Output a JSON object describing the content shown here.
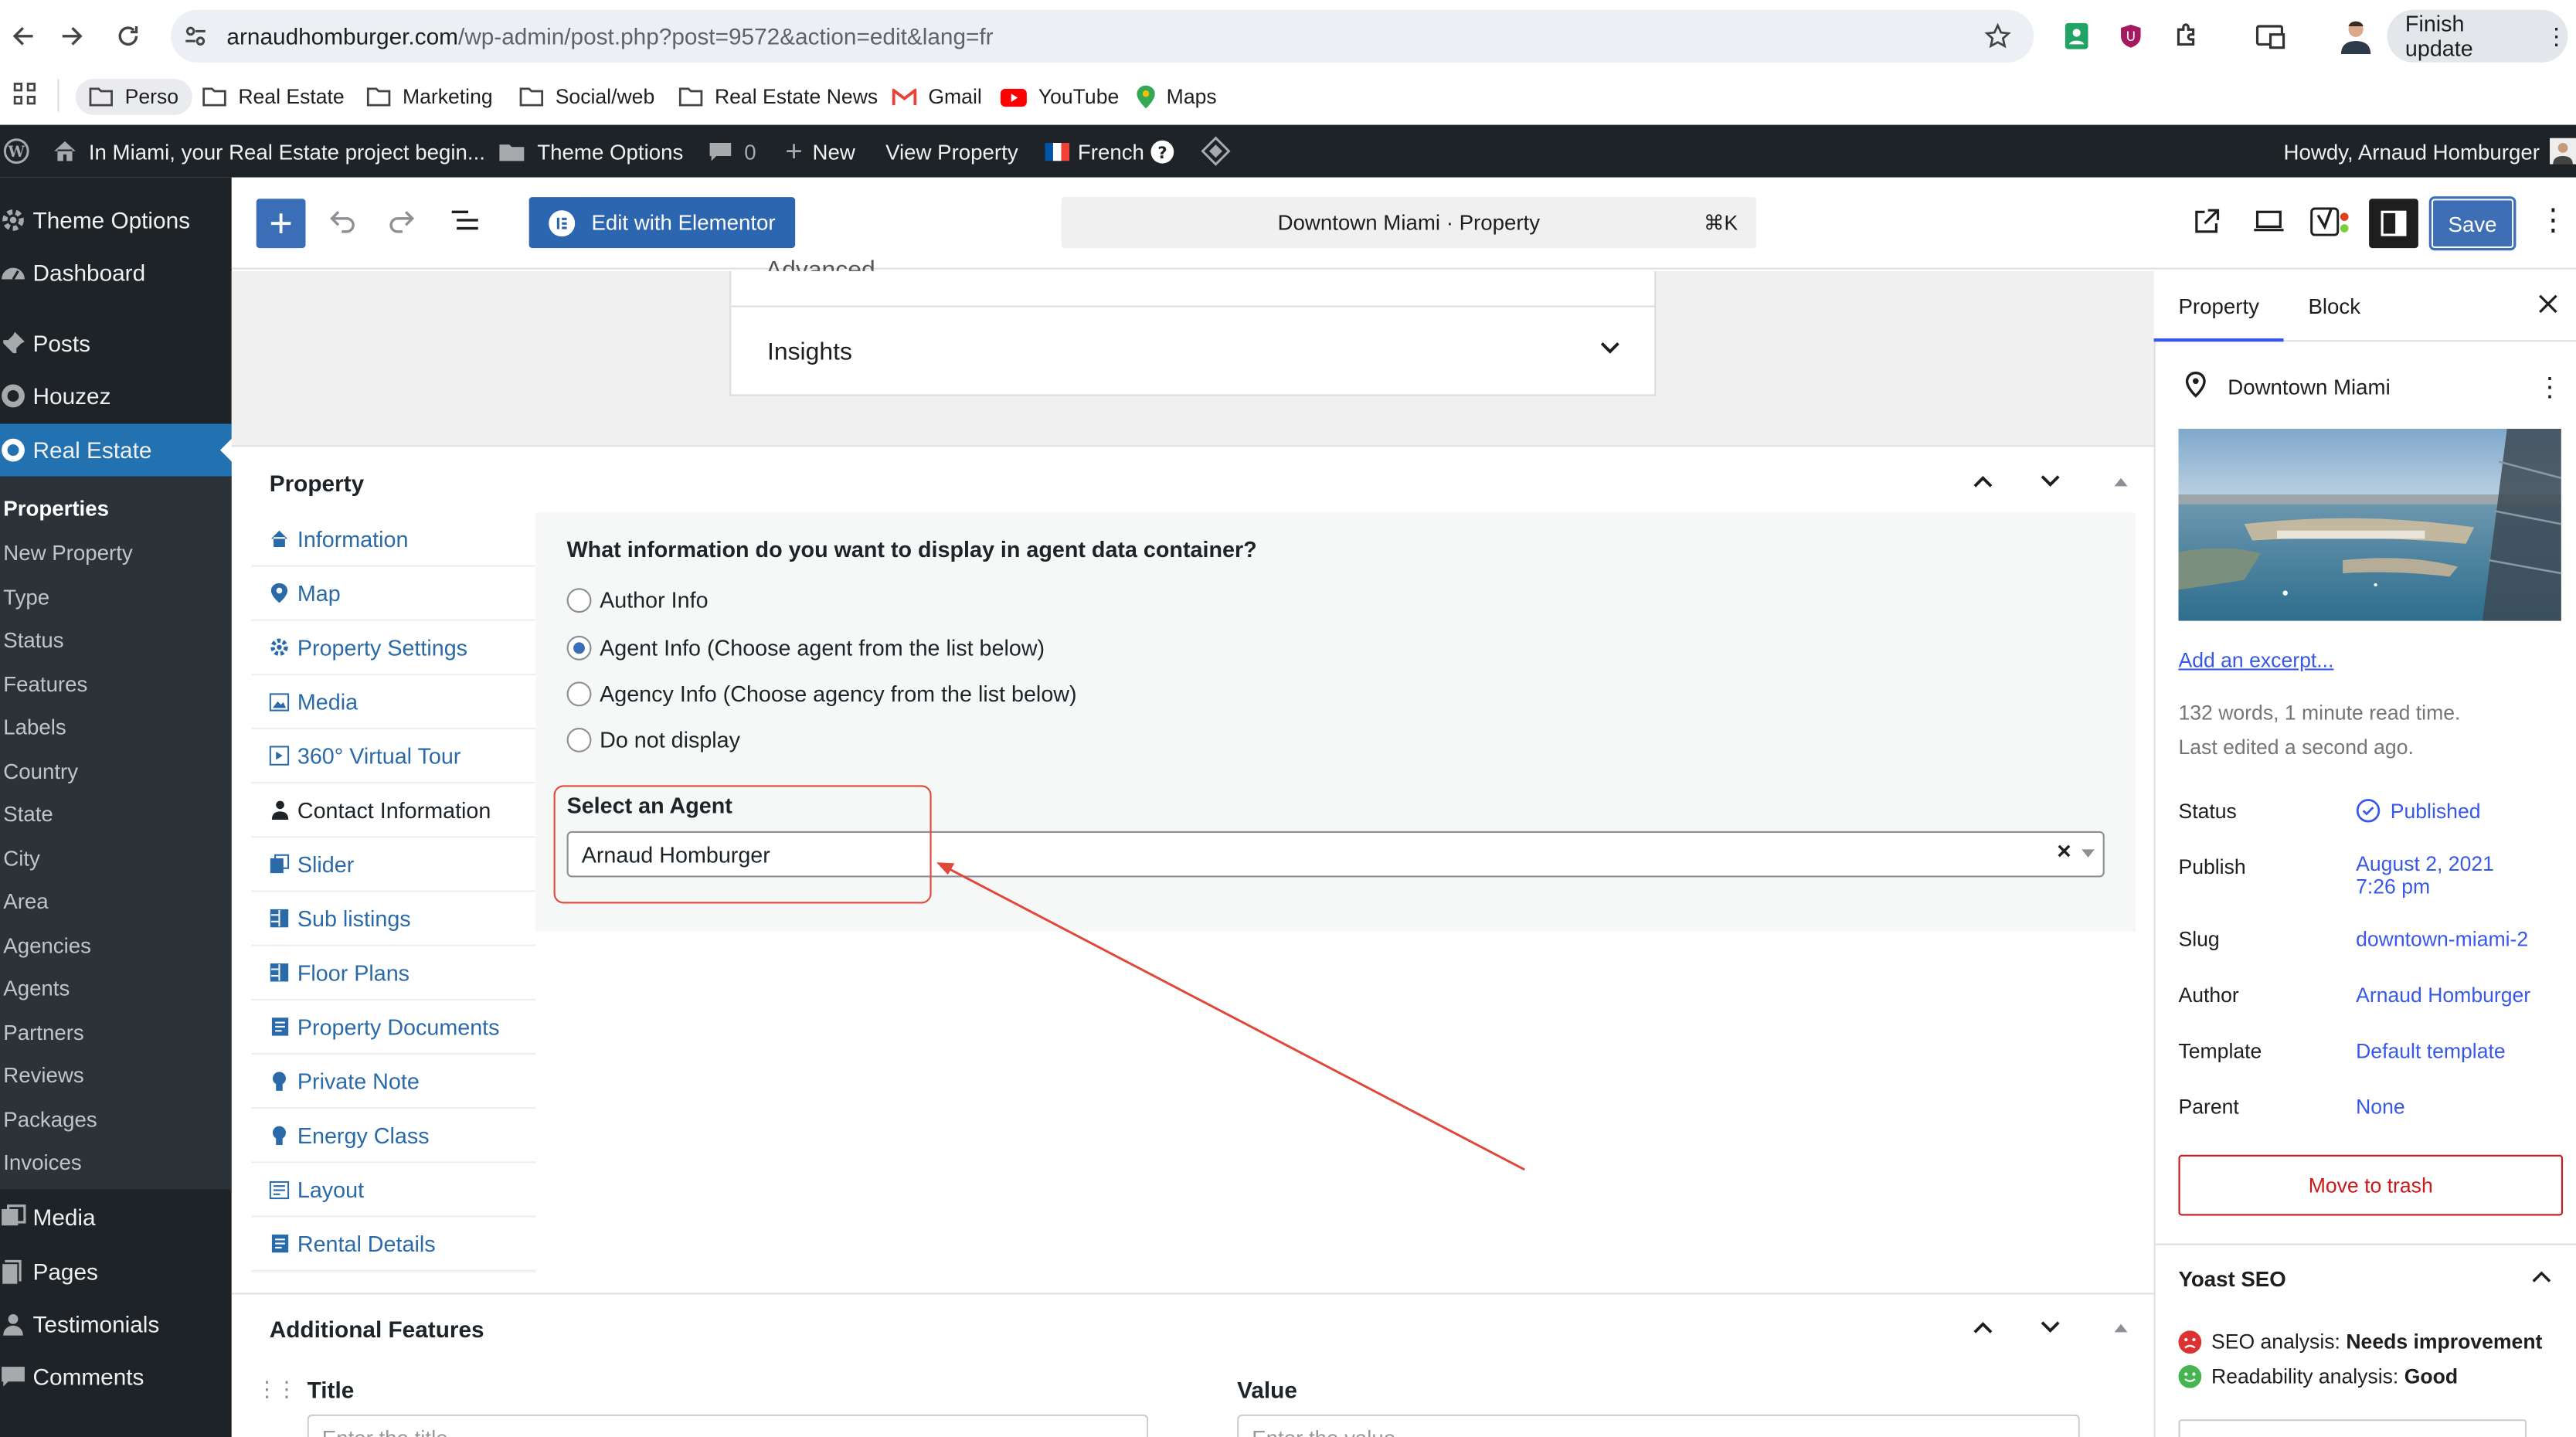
{
  "browser": {
    "url_domain": "arnaudhomburger.com",
    "url_path": "/wp-admin/post.php?post=9572&action=edit&lang=fr",
    "finish_update_label": "Finish update",
    "bookmarks": [
      "Perso",
      "Real Estate",
      "Marketing",
      "Social/web",
      "Real Estate News",
      "Gmail",
      "YouTube",
      "Maps"
    ]
  },
  "admin_bar": {
    "site_name": "In Miami, your Real Estate project begin...",
    "theme_options": "Theme Options",
    "comments_count": "0",
    "new_label": "New",
    "view_property": "View Property",
    "language": "French",
    "howdy": "Howdy, Arnaud Homburger"
  },
  "sidebar": {
    "top_items": [
      "Theme Options",
      "Dashboard",
      "Posts",
      "Houzez",
      "Real Estate"
    ],
    "submenu_items": [
      "Properties",
      "New Property",
      "Type",
      "Status",
      "Features",
      "Labels",
      "Country",
      "State",
      "City",
      "Area",
      "Agencies",
      "Agents",
      "Partners",
      "Reviews",
      "Packages",
      "Invoices"
    ],
    "bottom_items": [
      "Media",
      "Pages",
      "Testimonials",
      "Comments"
    ]
  },
  "editor_header": {
    "elementor_label": "Edit with Elementor",
    "document_title": "Downtown Miami · Property",
    "shortcut": "⌘K",
    "save_label": "Save"
  },
  "canvas": {
    "advanced_label": "Advanced",
    "insights_label": "Insights"
  },
  "property_box": {
    "title": "Property",
    "tabs": [
      "Information",
      "Map",
      "Property Settings",
      "Media",
      "360° Virtual Tour",
      "Contact Information",
      "Slider",
      "Sub listings",
      "Floor Plans",
      "Property Documents",
      "Private Note",
      "Energy Class",
      "Layout",
      "Rental Details"
    ],
    "active_tab": "Contact Information",
    "question": "What information do you want to display in agent data container?",
    "options": [
      "Author Info",
      "Agent Info (Choose agent from the list below)",
      "Agency Info (Choose agency from the list below)",
      "Do not display"
    ],
    "selected_option": "Agent Info (Choose agent from the list below)",
    "select_agent_label": "Select an Agent",
    "selected_agent": "Arnaud Homburger",
    "clear_symbol": "×"
  },
  "additional_features": {
    "title": "Additional Features",
    "col_title": "Title",
    "col_value": "Value",
    "title_placeholder": "Enter the title",
    "value_placeholder": "Enter the value"
  },
  "settings_sidebar": {
    "tab_property": "Property",
    "tab_block": "Block",
    "post_title": "Downtown Miami",
    "excerpt_link": "Add an excerpt...",
    "word_count": "132 words, 1 minute read time.",
    "last_edited": "Last edited a second ago.",
    "rows": [
      {
        "label": "Status",
        "value": "Published"
      },
      {
        "label": "Publish",
        "value": "August 2, 2021",
        "value2": "7:26 pm"
      },
      {
        "label": "Slug",
        "value": "downtown-miami-2"
      },
      {
        "label": "Author",
        "value": "Arnaud Homburger"
      },
      {
        "label": "Template",
        "value": "Default template"
      },
      {
        "label": "Parent",
        "value": "None"
      }
    ],
    "trash_label": "Move to trash",
    "yoast_title": "Yoast SEO",
    "seo_label": "SEO analysis:",
    "seo_value": "Needs improvement",
    "readability_label": "Readability analysis:",
    "readability_value": "Good"
  },
  "colors": {
    "wp_dark": "#1d2327",
    "wp_blue": "#2271b1",
    "annotation_red": "#e0483a",
    "link_blue": "#3858e9"
  }
}
